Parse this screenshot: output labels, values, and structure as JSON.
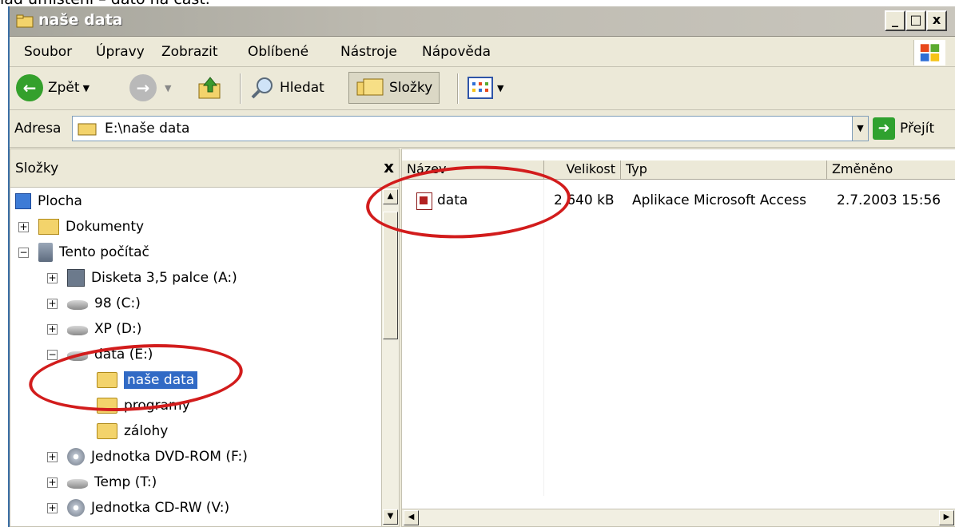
{
  "caption": "lad umístění – dato ná čast.",
  "window": {
    "title": "naše data",
    "caption_buttons": {
      "minimize": "_",
      "maximize": "□",
      "close": "x"
    }
  },
  "menu": [
    "Soubor",
    "Úpravy",
    "Zobrazit",
    "Oblíbené",
    "Nástroje",
    "Nápověda"
  ],
  "toolbar": {
    "back_label": "Zpět",
    "search_label": "Hledat",
    "folders_label": "Složky"
  },
  "address": {
    "label": "Adresa",
    "value": "E:\\naše data",
    "go_label": "Přejít"
  },
  "folders_pane": {
    "title": "Složky",
    "close": "x",
    "tree": [
      {
        "label": "Plocha",
        "icon": "desktop-icon"
      },
      {
        "label": "Dokumenty",
        "icon": "documents-folder-icon",
        "toggle": "+"
      },
      {
        "label": "Tento počítač",
        "icon": "my-computer-icon",
        "toggle": "−"
      },
      {
        "label": "Disketa 3,5 palce (A:)",
        "icon": "floppy-icon",
        "toggle": "+"
      },
      {
        "label": "98 (C:)",
        "icon": "drive-icon",
        "toggle": "+"
      },
      {
        "label": "XP (D:)",
        "icon": "drive-icon",
        "toggle": "+"
      },
      {
        "label": "data (E:)",
        "icon": "drive-icon",
        "toggle": "−"
      },
      {
        "label": "naše data",
        "icon": "open-folder-icon",
        "selected": true
      },
      {
        "label": "programy",
        "icon": "folder-icon"
      },
      {
        "label": "zálohy",
        "icon": "folder-icon"
      },
      {
        "label": "Jednotka DVD-ROM (F:)",
        "icon": "cd-drive-icon",
        "toggle": "+"
      },
      {
        "label": "Temp (T:)",
        "icon": "drive-icon",
        "toggle": "+"
      },
      {
        "label": "Jednotka CD-RW (V:)",
        "icon": "cd-drive-icon",
        "toggle": "+"
      }
    ]
  },
  "file_list": {
    "columns": [
      "Název",
      "Velikost",
      "Typ",
      "Změněno"
    ],
    "rows": [
      {
        "name": "data",
        "size": "2 640 kB",
        "type": "Aplikace Microsoft Access",
        "modified": "2.7.2003 15:56",
        "icon": "access-file-icon"
      }
    ]
  },
  "annotation_color": "#d21c1c"
}
